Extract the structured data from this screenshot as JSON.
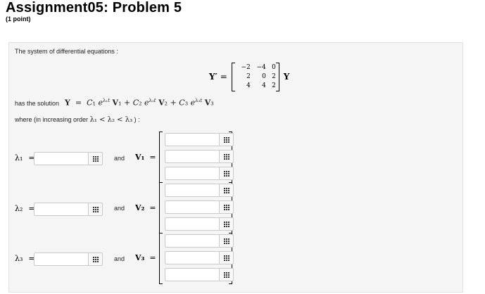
{
  "header": {
    "title": "Assignment05: Problem 5",
    "points": "(1 point)"
  },
  "problem": {
    "intro": "The system of differential equations :",
    "lhs": "Y′",
    "equals": "=",
    "matrix": [
      [
        "−2",
        "−4",
        "0"
      ],
      [
        "2",
        "0",
        "2"
      ],
      [
        "4",
        "4",
        "2"
      ]
    ],
    "rhs": "Y",
    "solution_prefix": "has the solution",
    "solution_expr": "Y = C₁ e^{λ₁t} V₁ + C₂ e^{λ₂t} V₂ + C₃ e^{λ₃t} V₃",
    "where_text": "where (in increasing order",
    "order_expr": "λ₁ < λ₂ < λ₃",
    "where_end": ") :"
  },
  "rows": [
    {
      "lambda_label": "λ₁",
      "eq": "=",
      "value": "",
      "and": "and",
      "vector_label": "V₁",
      "vector": [
        "",
        "",
        ""
      ]
    },
    {
      "lambda_label": "λ₂",
      "eq": "=",
      "value": "",
      "and": "and",
      "vector_label": "V₂",
      "vector": [
        "",
        "",
        ""
      ]
    },
    {
      "lambda_label": "λ₃",
      "eq": "=",
      "value": "",
      "and": "and",
      "vector_label": "V₃",
      "vector": [
        "",
        "",
        ""
      ]
    }
  ],
  "icons": {
    "answer_button": "grid-icon"
  }
}
